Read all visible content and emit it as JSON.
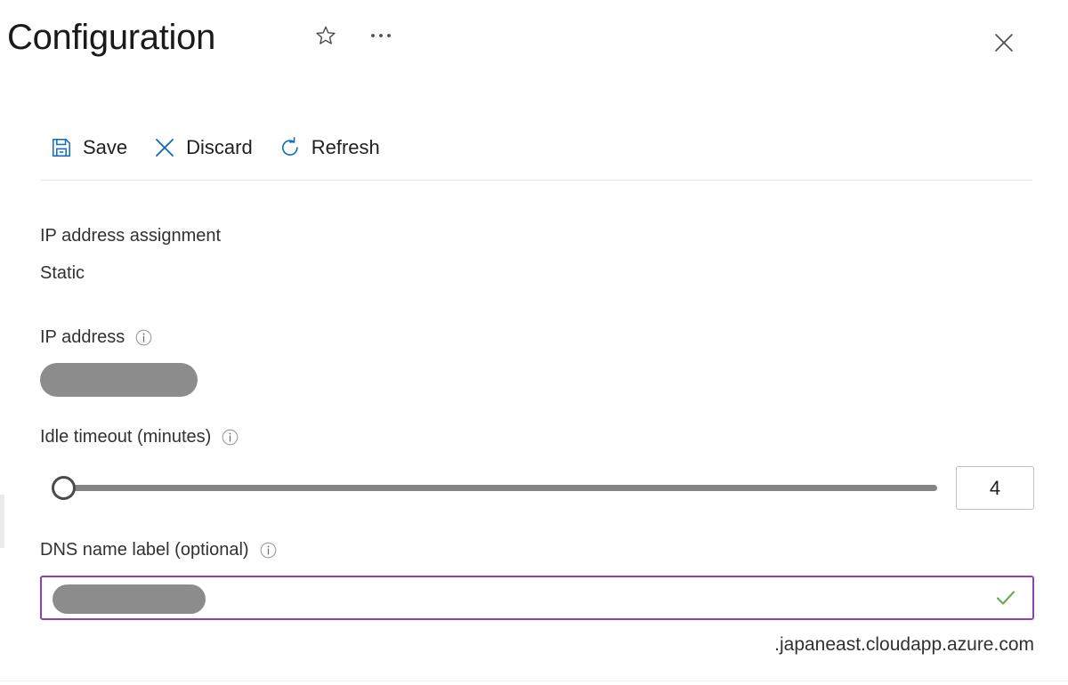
{
  "header": {
    "title": "Configuration",
    "favorite_icon": "star-outline-icon",
    "more_icon": "ellipsis-icon",
    "close_icon": "close-icon"
  },
  "commandbar": {
    "items": [
      {
        "label": "Save",
        "icon": "save-floppy-icon"
      },
      {
        "label": "Discard",
        "icon": "discard-x-icon"
      },
      {
        "label": "Refresh",
        "icon": "refresh-circular-arrow-icon"
      }
    ]
  },
  "form": {
    "ip_assignment": {
      "label": "IP address assignment",
      "value": "Static"
    },
    "ip_address": {
      "label": "IP address",
      "info_icon": "info-circle-icon",
      "value": "",
      "redacted": true
    },
    "idle_timeout": {
      "label": "Idle timeout (minutes)",
      "info_icon": "info-circle-icon",
      "value": "4",
      "min": "4",
      "max": "30",
      "slider_position_percent": 0
    },
    "dns_name_label": {
      "label": "DNS name label (optional)",
      "info_icon": "info-circle-icon",
      "value": "",
      "placeholder": "",
      "redacted": true,
      "validation_icon": "green-check-icon",
      "suffix": ".japaneast.cloudapp.azure.com"
    }
  },
  "colors": {
    "accent_blue": "#0f6cbd",
    "focus_purple": "#8f3fb8",
    "valid_green": "#6aa84f",
    "redaction_gray": "#8c8c8c",
    "text_primary": "#201f1e"
  }
}
